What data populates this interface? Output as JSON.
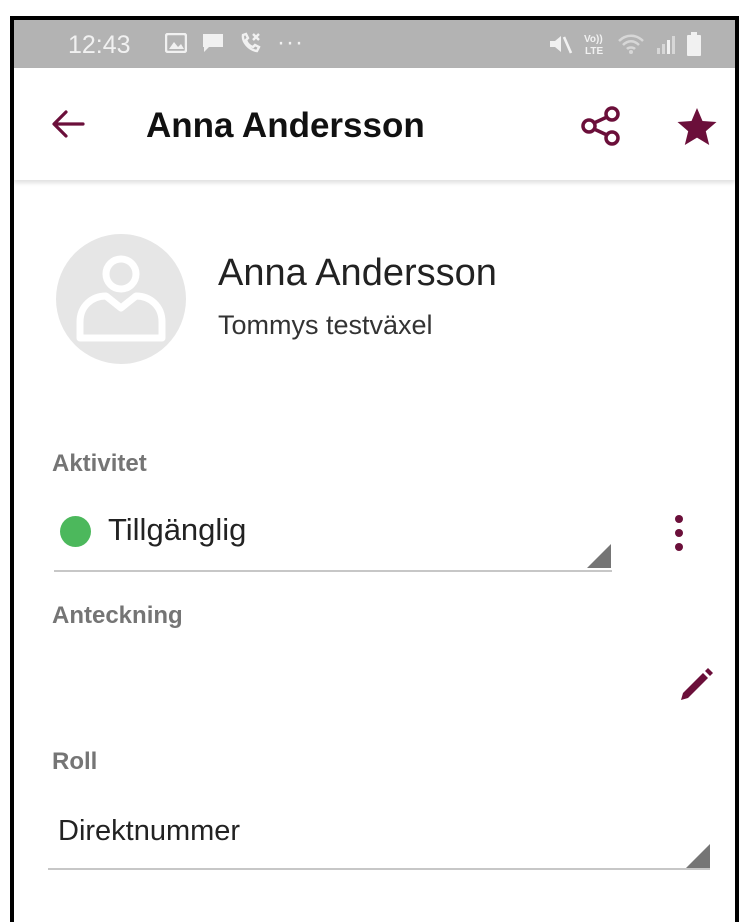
{
  "status_bar": {
    "time": "12:43",
    "overflow": "···",
    "left_icons": [
      "image-icon",
      "message-icon",
      "missed-call-icon"
    ],
    "right_icons": [
      "mute-icon",
      "volte-icon",
      "wifi-icon",
      "signal-icon",
      "battery-icon"
    ],
    "volte_top": "Vo))",
    "volte_bottom": "LTE"
  },
  "app_bar": {
    "title": "Anna Andersson",
    "actions": [
      "share-icon",
      "star-icon"
    ]
  },
  "contact": {
    "name": "Anna Andersson",
    "organization": "Tommys testväxel"
  },
  "activity": {
    "label": "Aktivitet",
    "value": "Tillgänglig",
    "status_color": "#4cb85c"
  },
  "note": {
    "label": "Anteckning",
    "value": ""
  },
  "role": {
    "label": "Roll",
    "value": "Direktnummer"
  },
  "colors": {
    "accent": "#6b0f3a",
    "status_bar": "#b3b3b3",
    "label_gray": "#757575"
  }
}
